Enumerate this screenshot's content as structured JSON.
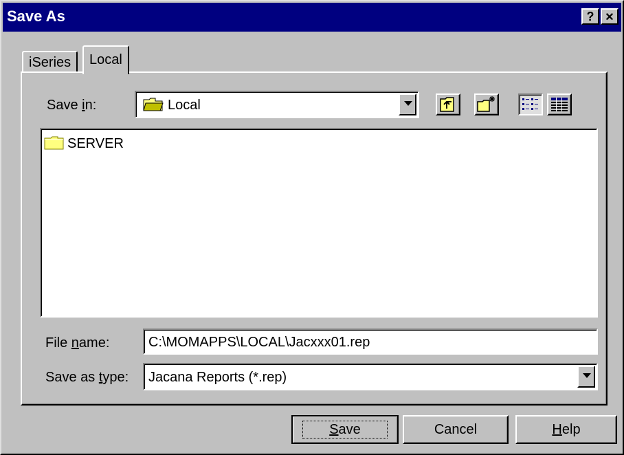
{
  "window": {
    "title": "Save As",
    "help_glyph": "?",
    "close_glyph": "✕"
  },
  "tabs": [
    {
      "label": "iSeries",
      "selected": false
    },
    {
      "label": "Local",
      "selected": true
    }
  ],
  "save_in": {
    "label_pre": "Save ",
    "label_mnemonic": "i",
    "label_post": "n:",
    "value": "Local",
    "icon": "folder-open-icon"
  },
  "toolbar": {
    "up_icon": "up-one-level-icon",
    "new_folder_icon": "new-folder-icon",
    "list_icon": "list-view-icon",
    "details_icon": "details-view-icon"
  },
  "files": [
    {
      "name": "SERVER",
      "icon": "folder-icon"
    }
  ],
  "file_name": {
    "label_pre": "File ",
    "label_mnemonic": "n",
    "label_post": "ame:",
    "value": "C:\\MOMAPPS\\LOCAL\\Jacxxx01.rep"
  },
  "save_type": {
    "label_pre": "Save as ",
    "label_mnemonic": "t",
    "label_post": "ype:",
    "value": "Jacana Reports (*.rep)"
  },
  "buttons": {
    "save_mnemonic": "S",
    "save_rest": "ave",
    "cancel": "Cancel",
    "help_mnemonic": "H",
    "help_rest": "elp"
  },
  "colors": {
    "titlebar": "#000080",
    "face": "#c0c0c0",
    "folder": "#ffff80"
  }
}
